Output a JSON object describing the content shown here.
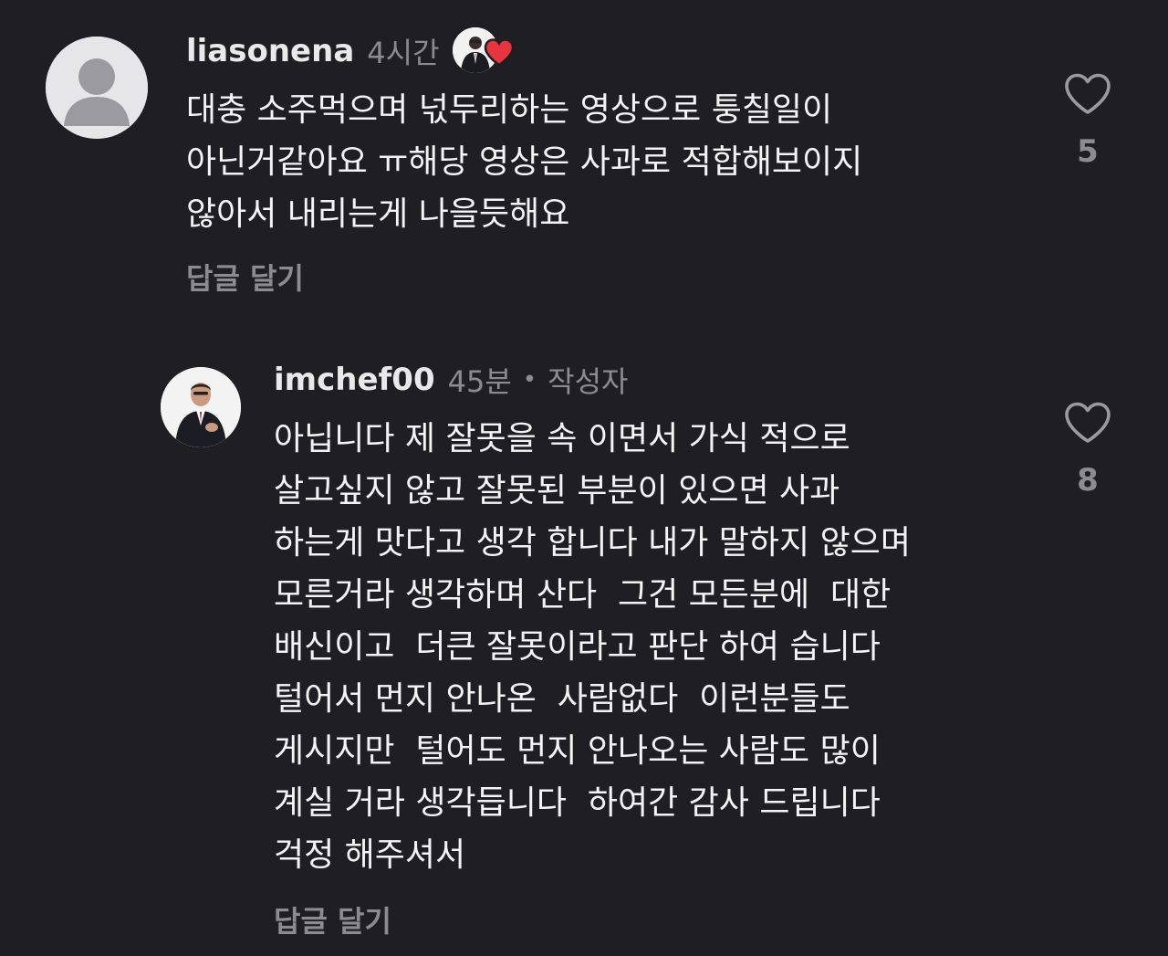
{
  "comments": [
    {
      "username": "liasonena",
      "time": "4시간",
      "text": "대충 소주먹으며 넋두리하는 영상으로 퉁칠일이\n아닌거같아요 ㅠ해당 영상은 사과로 적합해보이지\n않아서 내리는게 나을듯해요",
      "reply_label": "답글 달기",
      "like_count": "5",
      "icons": {
        "avatar": "default-user-avatar",
        "creator_liked": "creator-liked-heart-icon",
        "like": "heart-outline-icon"
      }
    },
    {
      "username": "imchef00",
      "time": "45분",
      "separator": "•",
      "author_tag": "작성자",
      "text": "아닙니다 제 잘못을 속 이면서 가식 적으로\n살고싶지 않고 잘못된 부분이 있으면 사과\n하는게 맛다고 생각 합니다 내가 말하지 않으며\n모른거라 생각하며 산다  그건 모든분에  대한\n배신이고  더큰 잘못이라고 판단 하여 습니다\n털어서 먼지 안나온  사람없다  이런분들도\n게시지만  털어도 먼지 안나오는 사람도 많이\n계실 거라 생각듭니다  하여간 감사 드립니다\n걱정 해주셔서",
      "reply_label": "답글 달기",
      "like_count": "8",
      "icons": {
        "avatar": "author-photo-avatar",
        "like": "heart-outline-icon"
      }
    }
  ],
  "colors": {
    "background": "#1f1f23",
    "primary_text": "#f4f4f4",
    "secondary_text": "#8c8c90",
    "heart_red": "#e8343f"
  }
}
